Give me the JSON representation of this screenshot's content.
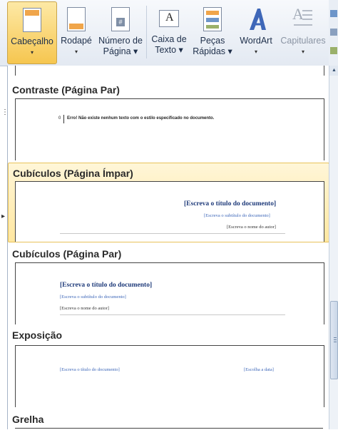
{
  "ribbon": {
    "buttons": [
      {
        "label1": "Cabeçalho",
        "label2": "▾",
        "name": "cabecalho"
      },
      {
        "label1": "Rodapé",
        "label2": "▾",
        "name": "rodape"
      },
      {
        "label1": "Número de",
        "label2": "Página ▾",
        "name": "numero-pagina"
      },
      {
        "label1": "Caixa de",
        "label2": "Texto ▾",
        "name": "caixa-texto"
      },
      {
        "label1": "Peças",
        "label2": "Rápidas ▾",
        "name": "pecas-rapidas"
      },
      {
        "label1": "WordArt",
        "label2": "▾",
        "name": "wordart"
      },
      {
        "label1": "Capitulares",
        "label2": "▾",
        "name": "capitulares"
      }
    ],
    "icon_a": "A"
  },
  "gallery": {
    "sections": [
      {
        "title": "Contraste (Página Par)"
      },
      {
        "title": "Cubículos (Página Ímpar)"
      },
      {
        "title": "Cubículos (Página Par)"
      },
      {
        "title": "Exposição"
      },
      {
        "title": "Grelha"
      }
    ],
    "contraste": {
      "page_number": "0",
      "error_text": "Erro! Não existe nenhum texto com o estilo especificado no documento."
    },
    "cubiculos_impar": {
      "title": "[Escreva o título do documento]",
      "subtitle": "[Escreva o subtítulo do documento]",
      "author": "[Escreva o nome do autor]"
    },
    "cubiculos_par": {
      "title": "[Escreva o título do documento]",
      "subtitle": "[Escreva o subtítulo do documento]",
      "author": "[Escreva o nome do autor]"
    },
    "exposicao": {
      "title": "[Escreva o título do documento]",
      "date": "[Escolha a data]"
    }
  }
}
